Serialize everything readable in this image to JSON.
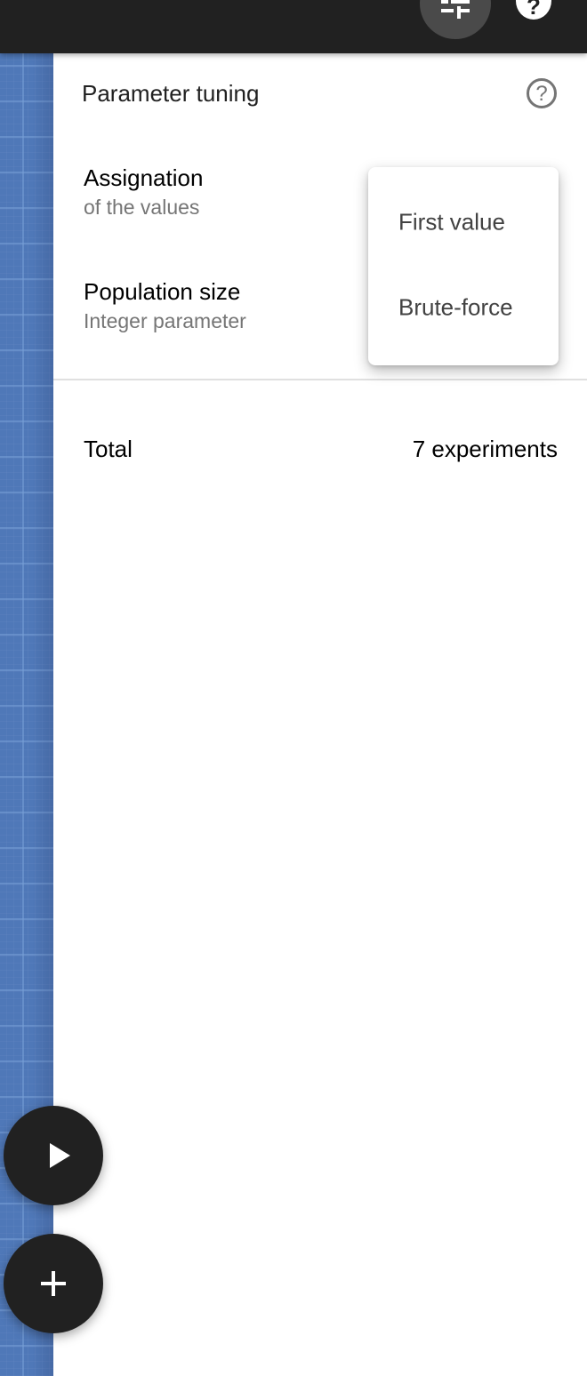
{
  "topbar": {
    "tune_button_icon": "tune-icon",
    "help_button_icon": "help-icon",
    "help_glyph": "?"
  },
  "panel": {
    "title": "Parameter tuning",
    "help_icon": "help-circle-outline-icon",
    "help_glyph": "?",
    "parameters": [
      {
        "name": "Assignation",
        "subtitle": "of the values"
      },
      {
        "name": "Population size",
        "subtitle": "Integer parameter"
      }
    ],
    "total": {
      "label": "Total",
      "value": "7 experiments"
    }
  },
  "dropdown": {
    "options": [
      "First value",
      "Brute-force"
    ]
  },
  "fabs": {
    "run": {
      "icon": "play-icon"
    },
    "add": {
      "icon": "plus-icon"
    }
  },
  "colors": {
    "topbar": "#212121",
    "canvas_blue": "#4f78b8",
    "fab": "#212121",
    "secondary_text": "#757575"
  }
}
